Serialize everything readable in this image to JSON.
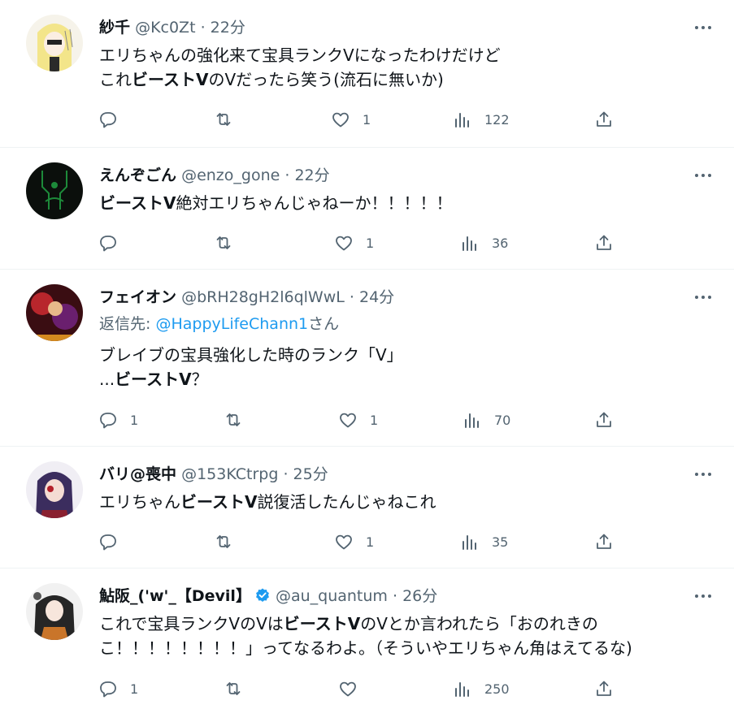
{
  "tweets": [
    {
      "name": "紗千",
      "handle": "@Kc0Zt",
      "dot": "·",
      "time": "22分",
      "lines": [
        [
          {
            "t": "エリちゃんの強化来て宝具ランクVになったわけだけど",
            "b": false
          }
        ],
        [
          {
            "t": "これ",
            "b": false
          },
          {
            "t": "ビーストV",
            "b": true
          },
          {
            "t": "のVだったら笑う(流石に無いか)",
            "b": false
          }
        ]
      ],
      "reply_count": "",
      "retweet_count": "",
      "like_count": "1",
      "view_count": "122"
    },
    {
      "name": "えんぞごん",
      "handle": "@enzo_gone",
      "dot": "·",
      "time": "22分",
      "lines": [
        [
          {
            "t": "ビーストV",
            "b": true
          },
          {
            "t": "絶対エリちゃんじゃねーか！！！！！",
            "b": false
          }
        ]
      ],
      "reply_count": "",
      "retweet_count": "",
      "like_count": "1",
      "view_count": "36"
    },
    {
      "name": "フェイオン",
      "handle": "@bRH28gH2l6qlWwL",
      "dot": "·",
      "time": "24分",
      "reply_label": "返信先:",
      "reply_mention": "@HappyLifeChann1",
      "reply_suffix": "さん",
      "lines": [
        [
          {
            "t": "ブレイブの宝具強化した時のランク「V」",
            "b": false
          }
        ],
        [
          {
            "t": "...",
            "b": false
          },
          {
            "t": "ビーストV",
            "b": true
          },
          {
            "t": "？",
            "b": false
          }
        ]
      ],
      "reply_count": "1",
      "retweet_count": "",
      "like_count": "1",
      "view_count": "70"
    },
    {
      "name": "バリ@喪中",
      "handle": "@153KCtrpg",
      "dot": "·",
      "time": "25分",
      "lines": [
        [
          {
            "t": "エリちゃん",
            "b": false
          },
          {
            "t": "ビーストV",
            "b": true
          },
          {
            "t": "説復活したんじゃねこれ",
            "b": false
          }
        ]
      ],
      "reply_count": "",
      "retweet_count": "",
      "like_count": "1",
      "view_count": "35"
    },
    {
      "name": "鮎阪_('w'_【Devil】",
      "handle": "@au_quantum",
      "dot": "·",
      "time": "26分",
      "verified": true,
      "lines": [
        [
          {
            "t": "これで宝具ランクVのVは",
            "b": false
          },
          {
            "t": "ビーストV",
            "b": true
          },
          {
            "t": "のVとか言われたら「おのれきの",
            "b": false
          }
        ],
        [
          {
            "t": "こ！！！！！！！！」ってなるわよ。（そういやエリちゃん角はえてるな)",
            "b": false
          }
        ]
      ],
      "reply_count": "1",
      "retweet_count": "",
      "like_count": "",
      "view_count": "250"
    }
  ],
  "icons": {
    "reply": "reply-icon",
    "retweet": "retweet-icon",
    "like": "heart-icon",
    "views": "views-chart-icon",
    "share": "share-icon",
    "more": "more-icon",
    "verified": "verified-badge-icon"
  },
  "colors": {
    "text": "#0f1419",
    "secondary": "#536471",
    "link": "#1d9bf0",
    "divider": "#eff3f4"
  }
}
